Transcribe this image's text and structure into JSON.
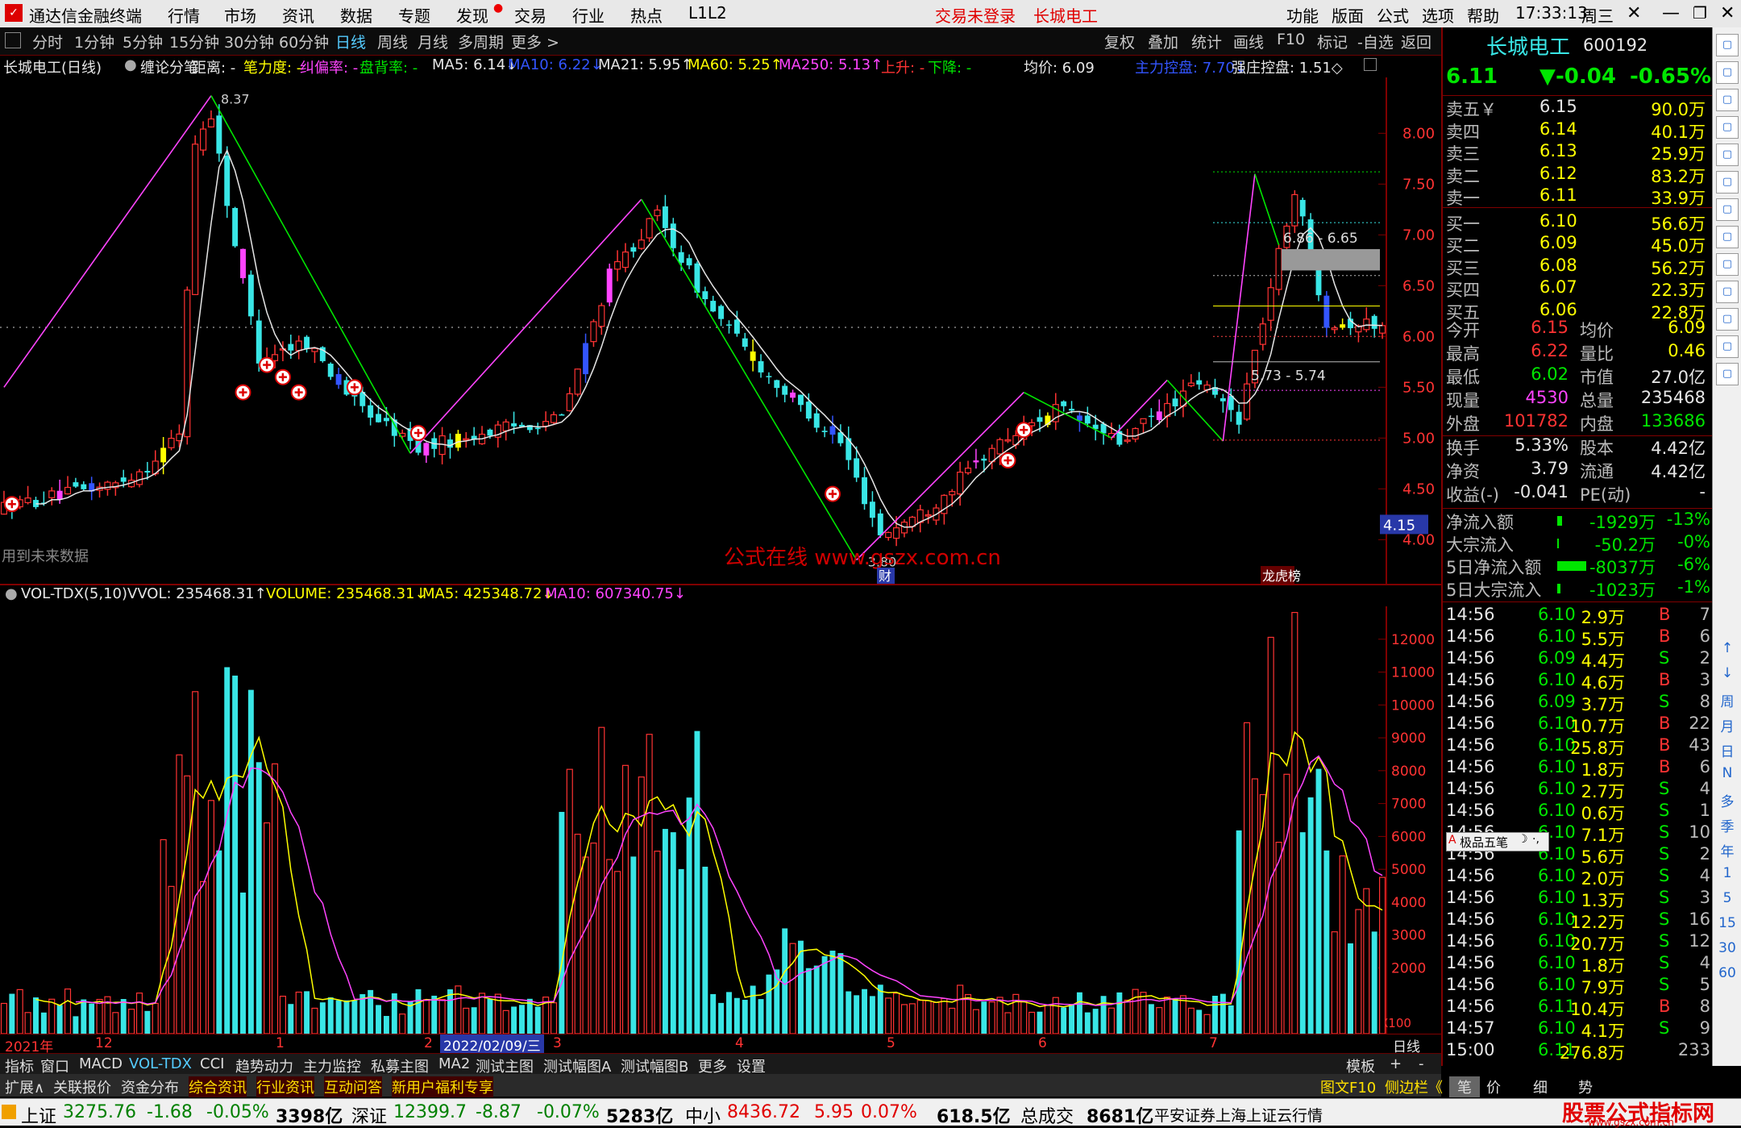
{
  "app": {
    "title": "通达信金融终端",
    "menu": [
      "行情",
      "市场",
      "资讯",
      "数据",
      "专题",
      "发现",
      "交易",
      "行业",
      "热点",
      "L1L2"
    ],
    "login_status": "交易未登录",
    "stock_tag": "长城电工",
    "right_menu": [
      "功能",
      "版面",
      "公式",
      "选项",
      "帮助"
    ],
    "clock": "17:33:13",
    "weekday": "周三"
  },
  "periods": [
    "分时",
    "1分钟",
    "5分钟",
    "15分钟",
    "30分钟",
    "60分钟",
    "日线",
    "周线",
    "月线",
    "多周期",
    "更多 >"
  ],
  "selected_period": "日线",
  "toolbar_right": [
    "复权",
    "叠加",
    "统计",
    "画线",
    "F10",
    "标记",
    "-自选",
    "返回"
  ],
  "indicator_line": {
    "stock": "长城电工(日线)",
    "label": "缠论分笔",
    "items": [
      {
        "text": "距离: -",
        "color": "#e6e6e6"
      },
      {
        "text": "笔力度: -",
        "color": "#ffff00"
      },
      {
        "text": "纠偏率: -",
        "color": "#ff44ff"
      },
      {
        "text": "盘背率: -",
        "color": "#00e600"
      },
      {
        "text": "MA5: 6.14↓",
        "color": "#e6e6e6"
      },
      {
        "text": "MA10: 6.22↓",
        "color": "#3355ff"
      },
      {
        "text": "MA21: 5.95↑",
        "color": "#e6e6e6"
      },
      {
        "text": "MA60: 5.25↑",
        "color": "#ffff00"
      },
      {
        "text": "MA250: 5.13↑",
        "color": "#ff44ff"
      },
      {
        "text": "上升: -",
        "color": "#ff3333"
      },
      {
        "text": "下降: -",
        "color": "#00e600"
      },
      {
        "text": "均价: 6.09",
        "color": "#e6e6e6"
      },
      {
        "text": "主力控盘: 7.70↓",
        "color": "#3355ff"
      },
      {
        "text": "强庄控盘: 1.51◇",
        "color": "#e6e6e6"
      }
    ]
  },
  "main_chart": {
    "y_ticks": [
      "8.00",
      "7.50",
      "7.00",
      "6.50",
      "6.00",
      "5.50",
      "5.00",
      "4.50",
      "4.00"
    ],
    "y_range": [
      3.55,
      8.55
    ],
    "high_label": "8.37",
    "low_label": "3.80",
    "current_price_tag": "4.15",
    "band_upper": "6.86 - 6.65",
    "band_lower": "5.73 - 5.74",
    "note_future": "用到未来数据",
    "watermark": "公式在线  www.gszx.com.cn",
    "marker_cai": "财",
    "marker_lh": "龙虎榜"
  },
  "vol_line": {
    "label": "VOL-TDX(5,10)",
    "vvol": "VVOL: 235468.31↑",
    "volume": "VOLUME: 235468.31↓",
    "ma5": "MA5: 425348.72↓",
    "ma10": "MA10: 607340.75↓"
  },
  "vol_chart": {
    "y_ticks": [
      "12000",
      "11000",
      "10000",
      "9000",
      "8000",
      "7000",
      "6000",
      "5000",
      "4000",
      "3000",
      "2000"
    ],
    "unit": "X100"
  },
  "x_axis": {
    "labels": [
      "2021年",
      "12",
      "1",
      "2",
      "2022/02/09/三",
      "3",
      "4",
      "5",
      "6",
      "7",
      "日线"
    ]
  },
  "tabs_row1": [
    "指标",
    "窗口",
    "MACD",
    "VOL-TDX",
    "CCI",
    "趋势动力",
    "主力监控",
    "私募主图",
    "MA2",
    "测试主图",
    "测试幅图A",
    "测试幅图B",
    "更多",
    "设置"
  ],
  "tabs_row1_right": [
    "模板",
    "+",
    "-"
  ],
  "tabs_row2": [
    "扩展∧",
    "关联报价",
    "资金分布",
    "综合资讯",
    "行业资讯",
    "互动问答",
    "新用户福利专享"
  ],
  "tabs_row2_right": [
    "图文F10",
    "侧边栏《",
    "笔",
    "价",
    "细",
    "势"
  ],
  "quote": {
    "name": "长城电工",
    "code": "600192",
    "price": "6.11",
    "change": "▼-0.04",
    "pct": "-0.65%",
    "asks": [
      {
        "label": "卖五￥",
        "price": "6.15",
        "vol": "90.0万"
      },
      {
        "label": "卖四",
        "price": "6.14",
        "vol": "40.1万"
      },
      {
        "label": "卖三",
        "price": "6.13",
        "vol": "25.9万"
      },
      {
        "label": "卖二",
        "price": "6.12",
        "vol": "83.2万"
      },
      {
        "label": "卖一",
        "price": "6.11",
        "vol": "33.9万"
      }
    ],
    "bids": [
      {
        "label": "买一",
        "price": "6.10",
        "vol": "56.6万"
      },
      {
        "label": "买二",
        "price": "6.09",
        "vol": "45.0万"
      },
      {
        "label": "买三",
        "price": "6.08",
        "vol": "56.2万"
      },
      {
        "label": "买四",
        "price": "6.07",
        "vol": "22.3万"
      },
      {
        "label": "买五",
        "price": "6.06",
        "vol": "22.8万"
      }
    ],
    "stats": [
      {
        "k1": "今开",
        "v1": "6.15",
        "c1": "rd",
        "k2": "均价",
        "v2": "6.09",
        "c2": "yl"
      },
      {
        "k1": "最高",
        "v1": "6.22",
        "c1": "rd",
        "k2": "量比",
        "v2": "0.46",
        "c2": "yl"
      },
      {
        "k1": "最低",
        "v1": "6.02",
        "c1": "gn",
        "k2": "市值",
        "v2": "27.0亿",
        "c2": "wt"
      },
      {
        "k1": "现量",
        "v1": "4530",
        "c1": "mg",
        "k2": "总量",
        "v2": "235468",
        "c2": "wt"
      },
      {
        "k1": "外盘",
        "v1": "101782",
        "c1": "rd",
        "k2": "内盘",
        "v2": "133686",
        "c2": "gn"
      }
    ],
    "fund": [
      {
        "k1": "换手",
        "v1": "5.33%",
        "k2": "股本",
        "v2": "4.42亿"
      },
      {
        "k1": "净资",
        "v1": "3.79",
        "k2": "流通",
        "v2": "4.42亿"
      },
      {
        "k1": "收益(-)",
        "v1": "-0.041",
        "k2": "PE(动)",
        "v2": "-"
      }
    ],
    "flows": [
      {
        "k": "净流入额",
        "v": "-1929万",
        "p": "-13%",
        "bar": 6
      },
      {
        "k": "大宗流入",
        "v": "-50.2万",
        "p": "-0%",
        "bar": 2
      },
      {
        "k": "5日净流入额",
        "v": "-8037万",
        "p": "-6%",
        "bar": 36
      },
      {
        "k": "5日大宗流入",
        "v": "-1023万",
        "p": "-1%",
        "bar": 4
      }
    ]
  },
  "ticks": [
    {
      "t": "14:56",
      "p": "6.10",
      "v": "2.9万",
      "s": "B",
      "n": "7"
    },
    {
      "t": "14:56",
      "p": "6.10",
      "v": "5.5万",
      "s": "B",
      "n": "6"
    },
    {
      "t": "14:56",
      "p": "6.09",
      "v": "4.4万",
      "s": "S",
      "n": "2"
    },
    {
      "t": "14:56",
      "p": "6.10",
      "v": "4.6万",
      "s": "B",
      "n": "3"
    },
    {
      "t": "14:56",
      "p": "6.09",
      "v": "3.7万",
      "s": "S",
      "n": "8"
    },
    {
      "t": "14:56",
      "p": "6.10",
      "v": "10.7万",
      "s": "B",
      "n": "22"
    },
    {
      "t": "14:56",
      "p": "6.10",
      "v": "25.8万",
      "s": "B",
      "n": "43"
    },
    {
      "t": "14:56",
      "p": "6.10",
      "v": "1.8万",
      "s": "B",
      "n": "6"
    },
    {
      "t": "14:56",
      "p": "6.10",
      "v": "2.7万",
      "s": "S",
      "n": "4"
    },
    {
      "t": "14:56",
      "p": "6.10",
      "v": "0.6万",
      "s": "S",
      "n": "1"
    },
    {
      "t": "14:56",
      "p": "6.10",
      "v": "7.1万",
      "s": "S",
      "n": "10"
    },
    {
      "t": "14:56",
      "p": "6.10",
      "v": "5.6万",
      "s": "S",
      "n": "2"
    },
    {
      "t": "14:56",
      "p": "6.10",
      "v": "2.0万",
      "s": "S",
      "n": "4"
    },
    {
      "t": "14:56",
      "p": "6.10",
      "v": "1.3万",
      "s": "S",
      "n": "3"
    },
    {
      "t": "14:56",
      "p": "6.10",
      "v": "12.2万",
      "s": "S",
      "n": "16"
    },
    {
      "t": "14:56",
      "p": "6.10",
      "v": "20.7万",
      "s": "S",
      "n": "12"
    },
    {
      "t": "14:56",
      "p": "6.10",
      "v": "1.8万",
      "s": "S",
      "n": "4"
    },
    {
      "t": "14:56",
      "p": "6.10",
      "v": "7.9万",
      "s": "S",
      "n": "5"
    },
    {
      "t": "14:56",
      "p": "6.11",
      "v": "10.4万",
      "s": "B",
      "n": "8"
    },
    {
      "t": "14:57",
      "p": "6.10",
      "v": "4.1万",
      "s": "S",
      "n": "9"
    },
    {
      "t": "15:00",
      "p": "6.11",
      "v": "276.8万",
      "s": "",
      "n": "233"
    }
  ],
  "popup_label": "极品五笔",
  "side_tools": [
    "↑",
    "↓",
    "周",
    "月",
    "日",
    "N",
    "多",
    "季",
    "年",
    "1",
    "5",
    "15",
    "30",
    "60"
  ],
  "status": {
    "sh_name": "上证",
    "sh_val": "3275.76",
    "sh_chg": "-1.68",
    "sh_pct": "-0.05%",
    "sh_amt": "3398亿",
    "sz_name": "深证",
    "sz_val": "12399.7",
    "sz_chg": "-8.87",
    "sz_pct": "-0.07%",
    "sz_amt": "5283亿",
    "zx_name": "中小",
    "zx_val": "8436.72",
    "zx_chg": "5.95",
    "zx_pct": "0.07%",
    "zx_amt": "618.5亿",
    "total_name": "总成交",
    "total_amt": "8681亿",
    "broker": "平安证券上海上证云行情",
    "brand": "股票公式指标网",
    "brand_url": "www.gszx.com.cn"
  }
}
